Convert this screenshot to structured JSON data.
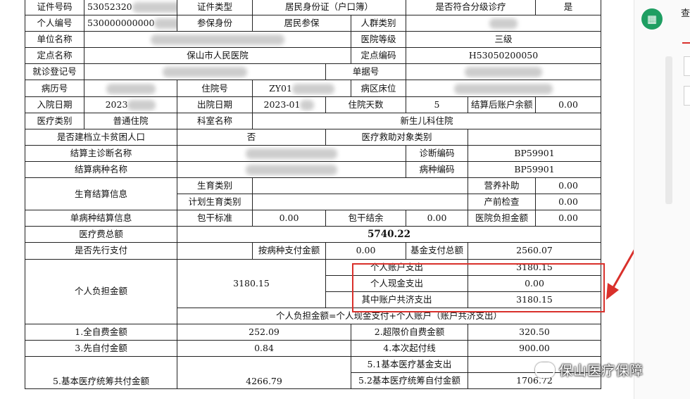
{
  "form": {
    "r1": {
      "l1": "证件号码",
      "v1": "53052320",
      "l2": "证件类型",
      "v2": "居民身份证（户口簿）",
      "l3": "是否符合分级诊疗",
      "v3": "是"
    },
    "r2": {
      "l1": "个人编号",
      "v1": "530000000000",
      "l2": "参保身份",
      "v2": "居民参保",
      "l3": "人群类别"
    },
    "r3": {
      "l1": "单位名称",
      "l3": "医院等级",
      "v3": "三级"
    },
    "r4": {
      "l1": "定点名称",
      "v1": "保山市人民医院",
      "l3": "定点编码",
      "v3": "H53050200050"
    },
    "r5": {
      "l1": "就诊登记号",
      "l2": "单据号"
    },
    "r6": {
      "l1": "病历号",
      "l2": "住院号",
      "v2": "ZY01",
      "l3": "病区床位"
    },
    "r7": {
      "l1": "入院日期",
      "v1": "2023",
      "l2": "出院日期",
      "v2": "2023-01",
      "l3": "住院天数",
      "v3": "5",
      "l4": "结算后账户余额",
      "v4": "0.00"
    },
    "r8": {
      "l1": "医疗类别",
      "v1": "普通住院",
      "l2": "科室名称",
      "v2": "新生儿科住院"
    },
    "r9": {
      "l1": "是否建档立卡贫困人口",
      "v1": "否",
      "l2": "医疗救助对象类别"
    },
    "r10": {
      "l1": "结算主诊断名称",
      "l2": "诊断编码",
      "v2": "BP59901"
    },
    "r11": {
      "l1": "结算病种名称",
      "l2": "病种编码",
      "v2": "BP59901"
    },
    "r12": {
      "l1": "生育结算信息",
      "a1": "生育类别",
      "b1": "营养补助",
      "b1v": "0.00",
      "a2": "计划生育类别",
      "b2": "产前检查",
      "b2v": "0.00"
    },
    "r13": {
      "l1": "单病种结算信息",
      "l2": "包干标准",
      "v2": "0.00",
      "l3": "包干结余",
      "v3": "0.00",
      "l4": "医院负担金额",
      "v4": "0.00"
    },
    "r14": {
      "l1": "医疗费总额",
      "v1": "5740.22"
    },
    "r15": {
      "l1": "是否先行支付",
      "l2": "按病种支付金额",
      "v2": "0.00",
      "l3": "基金支付总额",
      "v3": "2560.07"
    },
    "r16": {
      "l1": "个人负担金额",
      "v1": "3180.15",
      "a": "个人账户支出",
      "av": "3180.15",
      "b": "个人现金支出",
      "bv": "0.00",
      "c": "其中账户共济支出",
      "cv": "3180.15",
      "formula": "个人负担金额=个人现金支付+个人账户（账户共济支出）"
    },
    "r17": {
      "l1": "1.全自费金额",
      "v1": "252.09",
      "l2": "2.超限价自费金额",
      "v2": "320.50"
    },
    "r18": {
      "l1": "3.先自付金额",
      "v1": "0.84",
      "l2": "4.本次起付线",
      "v2": "900.00"
    },
    "r19": {
      "l2": "5.1基本医疗基金支出"
    },
    "r20": {
      "l1": "5.基本医疗统筹共付金额",
      "v1": "4266.79",
      "l2": "5.2基本医疗统筹自付金额",
      "v2": "1706.72"
    }
  },
  "sidebar": {
    "label": "查",
    "icon": "table-export-icon"
  },
  "watermark": {
    "text": "保山医疗保障"
  },
  "colors": {
    "highlight": "#d9302b",
    "accent": "#1e9e62"
  }
}
